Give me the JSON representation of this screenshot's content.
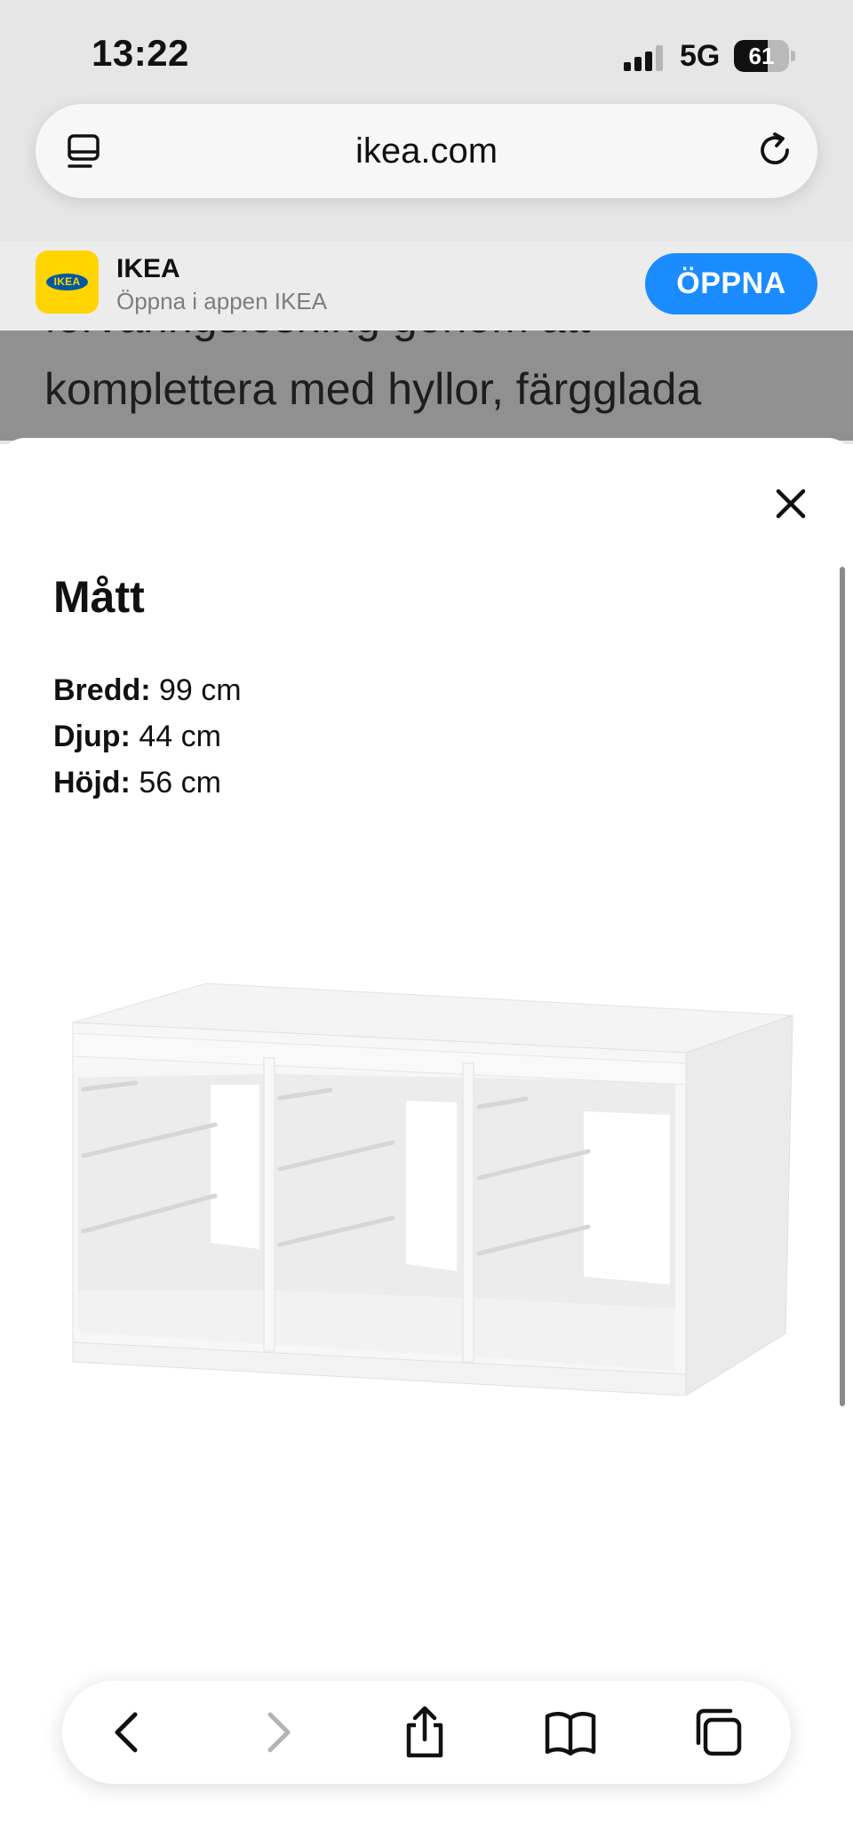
{
  "status_bar": {
    "time": "13:22",
    "network": "5G",
    "battery_level": "61",
    "battery_fraction": 0.61
  },
  "browser": {
    "url": "ikea.com"
  },
  "app_banner": {
    "app_name": "IKEA",
    "subtitle": "Öppna i appen IKEA",
    "open_label": "ÖPPNA",
    "logo_text": "IKEA",
    "accent_color": "#1a8cff",
    "brand_yellow": "#ffd400",
    "brand_blue": "#0058a3"
  },
  "page_behind": {
    "partial_line": "förvaringslösning genom att",
    "line": "komplettera med hyllor, färgglada"
  },
  "sheet": {
    "title": "Mått",
    "dimensions": [
      {
        "label": "Bredd:",
        "value": "99 cm"
      },
      {
        "label": "Djup:",
        "value": "44 cm"
      },
      {
        "label": "Höjd:",
        "value": "56 cm"
      }
    ]
  },
  "toolbar": {
    "icons": [
      "back-icon",
      "forward-icon",
      "share-icon",
      "bookmarks-icon",
      "tabs-icon"
    ]
  }
}
